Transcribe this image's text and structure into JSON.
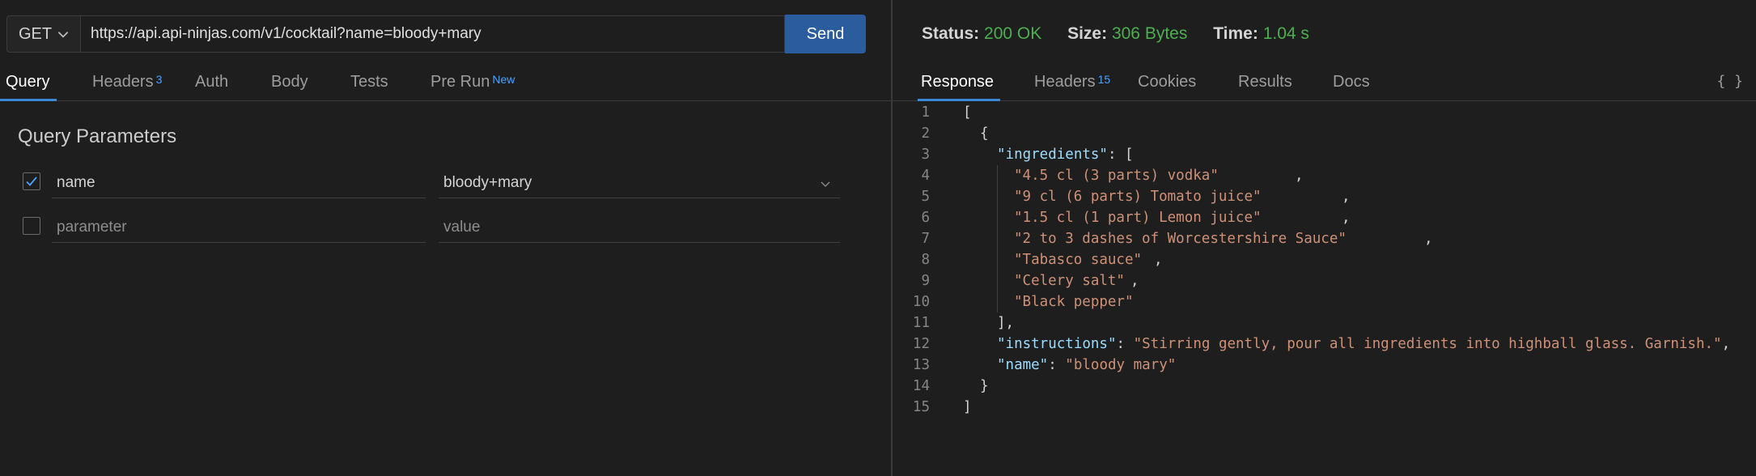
{
  "request": {
    "method": "GET",
    "url": "https://api.api-ninjas.com/v1/cocktail?name=bloody+mary",
    "send_label": "Send"
  },
  "request_tabs": [
    {
      "label": "Query",
      "badge": ""
    },
    {
      "label": "Headers",
      "badge": "3"
    },
    {
      "label": "Auth",
      "badge": ""
    },
    {
      "label": "Body",
      "badge": ""
    },
    {
      "label": "Tests",
      "badge": ""
    },
    {
      "label": "Pre Run",
      "badge": "New"
    }
  ],
  "query": {
    "title": "Query Parameters",
    "rows": [
      {
        "checked": true,
        "key": "name",
        "value": "bloody+mary"
      },
      {
        "checked": false,
        "key_placeholder": "parameter",
        "value_placeholder": "value"
      }
    ]
  },
  "response_meta": {
    "status_label": "Status:",
    "status_value": "200 OK",
    "size_label": "Size:",
    "size_value": "306 Bytes",
    "time_label": "Time:",
    "time_value": "1.04 s"
  },
  "response_tabs": [
    {
      "label": "Response",
      "badge": ""
    },
    {
      "label": "Headers",
      "badge": "15"
    },
    {
      "label": "Cookies",
      "badge": ""
    },
    {
      "label": "Results",
      "badge": ""
    },
    {
      "label": "Docs",
      "badge": ""
    }
  ],
  "format_toggle": "{ }",
  "response_body": {
    "line_numbers": [
      "1",
      "2",
      "3",
      "4",
      "5",
      "6",
      "7",
      "8",
      "9",
      "10",
      "11",
      "12",
      "13",
      "14",
      "15"
    ],
    "open_bracket": "[",
    "open_brace": "{",
    "ingredients_key": "\"ingredients\"",
    "ingredients_open": ": [",
    "ingredients": [
      "\"4.5 cl (3 parts) vodka\"",
      "\"9 cl (6 parts) Tomato juice\"",
      "\"1.5 cl (1 part) Lemon juice\"",
      "\"2 to 3 dashes of Worcestershire Sauce\"",
      "\"Tabasco sauce\"",
      "\"Celery salt\"",
      "\"Black pepper\""
    ],
    "ingredients_close": "],",
    "instructions_key": "\"instructions\"",
    "instructions_value": "\"Stirring gently, pour all ingredients into highball glass. Garnish.\"",
    "name_key": "\"name\"",
    "name_value": "\"bloody mary\"",
    "close_brace": "}",
    "close_bracket": "]"
  }
}
